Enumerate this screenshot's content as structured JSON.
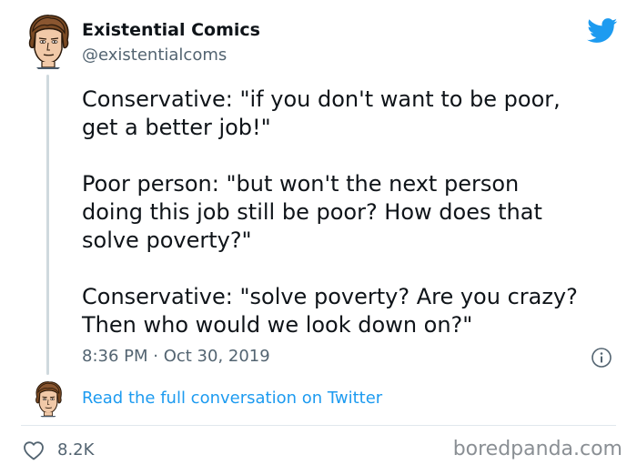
{
  "author": {
    "display_name": "Existential Comics",
    "handle": "@existentialcoms",
    "avatar_icon": "comic-portrait-avatar"
  },
  "tweet": {
    "paragraphs": [
      "Conservative: \"if you don't want to be poor,\nget a better job!\"",
      "Poor person: \"but won't the next person\ndoing this job still be poor? How does that\nsolve poverty?\"",
      "Conservative: \"solve poverty? Are you crazy?\nThen who would we look down on?\""
    ],
    "timestamp": "8:36 PM · Oct 30, 2019"
  },
  "conversation": {
    "link_text": "Read the full conversation on Twitter"
  },
  "actions": {
    "like_icon": "heart-icon",
    "like_count": "8.2K"
  },
  "watermark": "boredpanda.com",
  "colors": {
    "twitter_blue": "#1d9bf0",
    "text_primary": "#0f1419",
    "text_secondary": "#536471",
    "thread_line": "#cfd9de"
  }
}
